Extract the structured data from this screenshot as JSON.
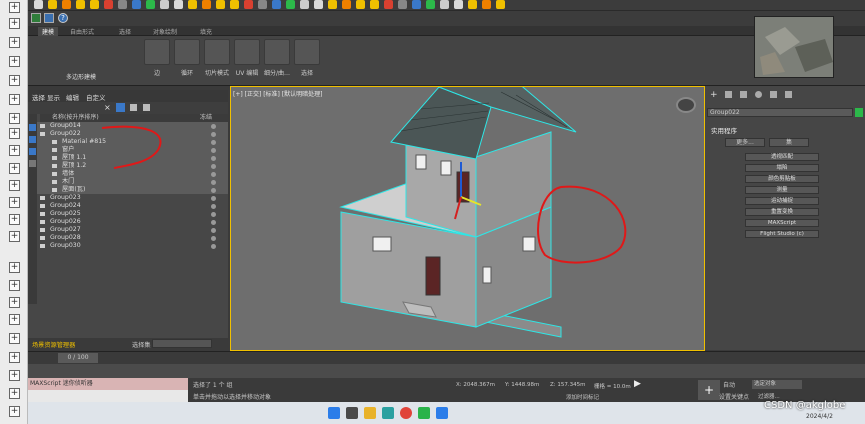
{
  "ribbon": {
    "tabs": [
      "建模",
      "自由形式",
      "选择",
      "对象绘制",
      "填充"
    ],
    "poly_label": "多边形建模",
    "buttons": [
      "边",
      "循环",
      "切片模式",
      "UV 编辑",
      "细分/曲…",
      "选择"
    ]
  },
  "scene_explorer": {
    "menu": [
      "选择",
      "显示",
      "编辑",
      "自定义"
    ],
    "header_name": "名称(按升序排序)",
    "header_frozen": "冻结",
    "rows": [
      {
        "label": "Group014",
        "indent": 0,
        "sel": true
      },
      {
        "label": "Group022",
        "indent": 0,
        "sel": true
      },
      {
        "label": "Material #815",
        "indent": 2,
        "sel": true
      },
      {
        "label": "窗户",
        "indent": 2,
        "sel": true
      },
      {
        "label": "屋顶 1.1",
        "indent": 2,
        "sel": true
      },
      {
        "label": "屋顶 1.2",
        "indent": 2,
        "sel": true
      },
      {
        "label": "墙体",
        "indent": 2,
        "sel": true
      },
      {
        "label": "木门",
        "indent": 2,
        "sel": true
      },
      {
        "label": "屋面(瓦)",
        "indent": 2,
        "sel": true
      },
      {
        "label": "Group023",
        "indent": 0,
        "sel": false
      },
      {
        "label": "Group024",
        "indent": 0,
        "sel": false
      },
      {
        "label": "Group025",
        "indent": 0,
        "sel": false
      },
      {
        "label": "Group026",
        "indent": 0,
        "sel": false
      },
      {
        "label": "Group027",
        "indent": 0,
        "sel": false
      },
      {
        "label": "Group028",
        "indent": 0,
        "sel": false
      },
      {
        "label": "Group030",
        "indent": 0,
        "sel": false
      }
    ],
    "bottom_label": "场景资源管理器",
    "selection_set_label": "选择集"
  },
  "viewport": {
    "label": "[+] [正交] [标准] [默认明暗处理]"
  },
  "command_panel": {
    "object_name": "Group022",
    "rollout_title": "实用程序",
    "more_button": "更多...",
    "sets_button": "集",
    "buttons": [
      "透视匹配",
      "塌陷",
      "颜色剪贴板",
      "测量",
      "运动捕捉",
      "重置变换",
      "MAXScript",
      "Flight Studio (c)"
    ]
  },
  "timeline": {
    "frame": "0 / 100"
  },
  "status": {
    "maxscript": "MAXScript 迷你侦听器",
    "selected": "选择了 1 个 组",
    "hint": "单击并拖动以选择并移动对象",
    "x": "X: 2048.367m",
    "y": "Y: 1448.98m",
    "z": "Z: 157.345m",
    "grid": "栅格 = 10.0m",
    "add_key": "添加时间标记",
    "auto_key": "自动",
    "set_key": "设置关键点",
    "filter": "选定对象",
    "filters_btn": "过滤器..."
  },
  "taskbar": {
    "date": "2024/4/2"
  },
  "watermark": "CSDN @akglobe",
  "colors": {
    "selection_cyan": "#2ee6e6",
    "annotation_red": "#e01818",
    "viewport_bg": "#6e6e6e",
    "frame_yellow": "#f0c000"
  }
}
